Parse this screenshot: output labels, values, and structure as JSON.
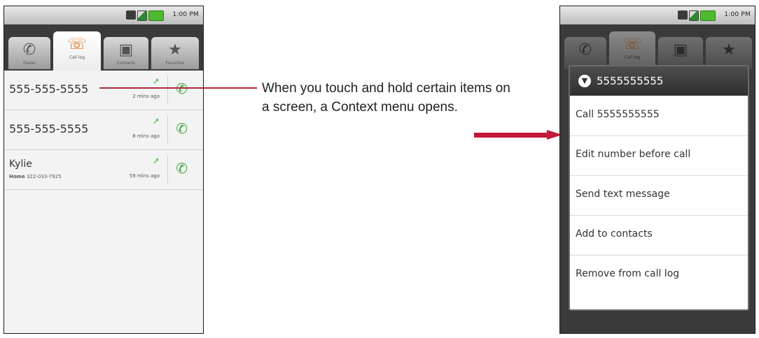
{
  "status_bar": {
    "time": "1:00 PM"
  },
  "tabs": [
    {
      "label": "Dialer",
      "icon": "phone-icon"
    },
    {
      "label": "Call log",
      "icon": "call-log-icon"
    },
    {
      "label": "Contacts",
      "icon": "contacts-icon"
    },
    {
      "label": "Favorites",
      "icon": "star-icon"
    }
  ],
  "call_log": [
    {
      "number": "555-555-5555",
      "ago": "2 mins ago"
    },
    {
      "number": "555-555-5555",
      "ago": "8 mins ago"
    },
    {
      "name": "Kylie",
      "detail_type": "Home",
      "detail_number": "322-033-7925",
      "ago": "59 mins ago"
    }
  ],
  "callout": {
    "text": "When you touch and hold certain items on a screen, a Context menu opens."
  },
  "context_menu": {
    "title": "5555555555",
    "items": [
      "Call 5555555555",
      "Edit number before call",
      "Send text message",
      "Add to contacts",
      "Remove from call log"
    ]
  },
  "colors": {
    "accent_orange": "#e0701a",
    "call_green": "#3aa53a",
    "callout_red": "#c2183a"
  }
}
